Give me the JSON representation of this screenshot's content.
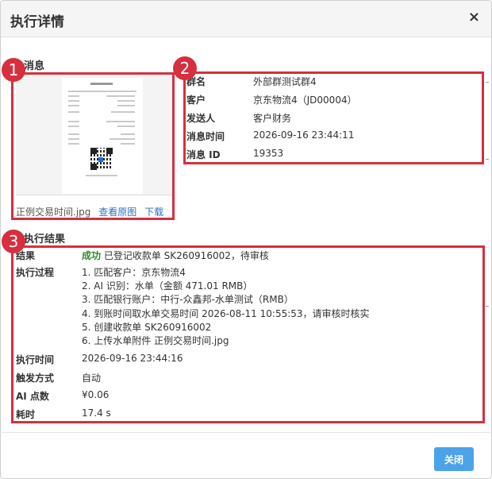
{
  "dialog": {
    "title": "执行详情",
    "close_symbol": "×"
  },
  "message_section": {
    "title": "消息",
    "file_name": "正例交易时间.jpg",
    "view_original_label": "查看原图",
    "download_label": "下载"
  },
  "message_info": [
    {
      "key": "群名",
      "value": "外部群测试群4"
    },
    {
      "key": "客户",
      "value": "京东物流4（JD00004）"
    },
    {
      "key": "发送人",
      "value": "客户财务"
    },
    {
      "key": "消息时间",
      "value": "2026-09-16 23:44:11"
    },
    {
      "key": "消息 ID",
      "value": "19353"
    }
  ],
  "result_section": {
    "title": "执行结果",
    "result_key": "结果",
    "result_status": "成功",
    "result_text": "已登记收款单 SK260916002，待审核",
    "process_key": "执行过程",
    "process_steps": [
      "1. 匹配客户：京东物流4",
      "2. AI 识别：水单（金额 471.01 RMB）",
      "3. 匹配银行账户：中行-众鑫邦-水单测试（RMB）",
      "4. 到账时间取水单交易时间 2026-08-11 10:55:53，请审核时核实",
      "5. 创建收款单 SK260916002",
      "6. 上传水单附件 正例交易时间.jpg"
    ],
    "rows": [
      {
        "key": "执行时间",
        "value": "2026-09-16 23:44:16"
      },
      {
        "key": "触发方式",
        "value": "自动"
      },
      {
        "key": "AI 点数",
        "value": "¥0.06"
      },
      {
        "key": "耗时",
        "value": "17.4 s"
      }
    ]
  },
  "annotations": {
    "badge_1": "1",
    "badge_2": "2",
    "badge_3": "3"
  },
  "footer": {
    "close_button_label": "关闭"
  },
  "colors": {
    "annotation_red": "#d62f3e",
    "success_green": "#2e8b2e",
    "link_blue": "#2a72c5",
    "button_blue": "#4da3e8"
  }
}
